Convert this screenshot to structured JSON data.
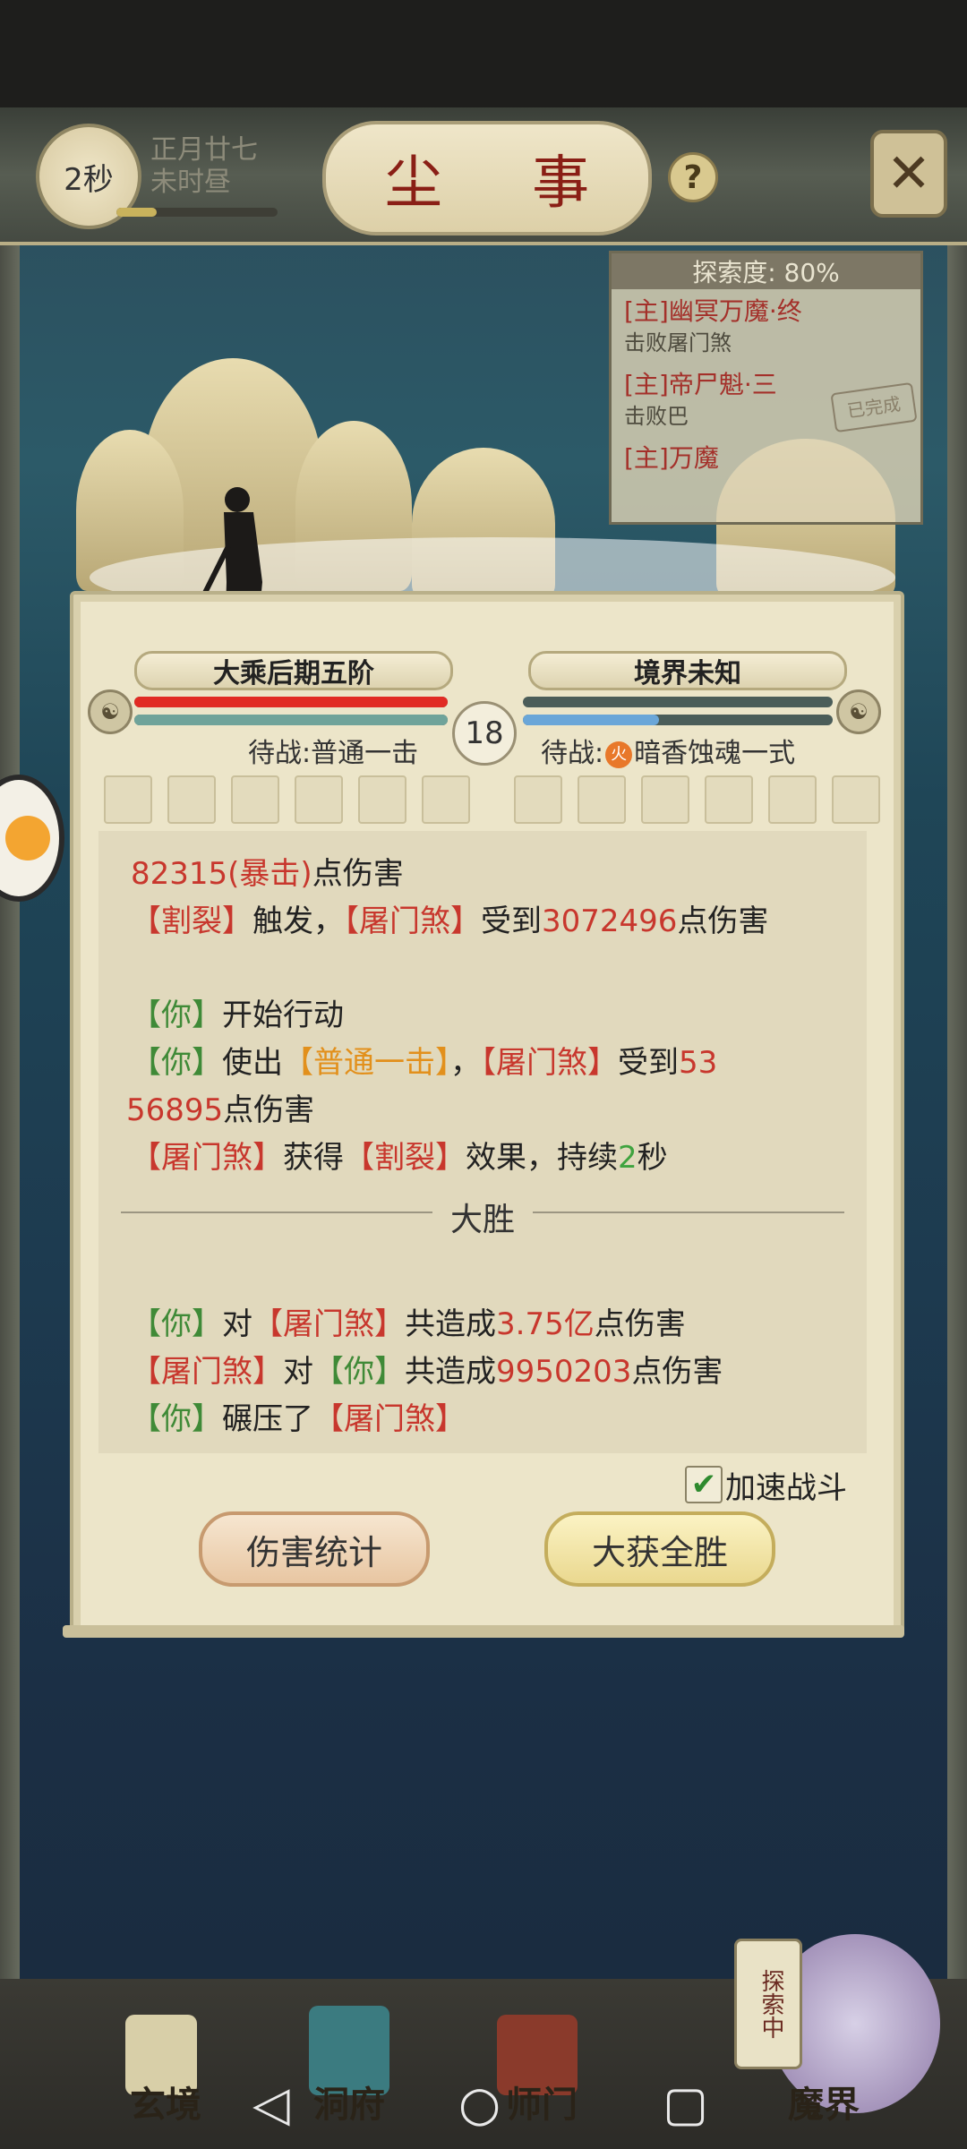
{
  "header": {
    "timer": "2秒",
    "date_line1": "正月廿七",
    "date_line2": "未时昼",
    "title": "尘 事",
    "help": "?"
  },
  "quest_panel": {
    "header": "探索度: 80%",
    "items": [
      {
        "title": "[主]幽冥万魔·终",
        "sub": "击败屠门煞"
      },
      {
        "title": "[主]帝尸魁·三",
        "sub": "击败巴"
      },
      {
        "title": "[主]万魔",
        "sub": ""
      }
    ],
    "stamp": "已完成"
  },
  "battle": {
    "player_realm": "大乘后期五阶",
    "enemy_realm": "境界未知",
    "round": "18",
    "player_status": "待战:普通一击",
    "enemy_status_prefix": "待战:",
    "enemy_element": "火",
    "enemy_status_skill": "暗香蚀魂一式",
    "player_hp": 1.0,
    "player_mp": 1.0,
    "enemy_hp": 0,
    "enemy_mp": 0.44
  },
  "log": {
    "l1_num": "82315",
    "l1_crit": "(暴击)",
    "l1_tail": "点伤害",
    "l2_a": "【割裂】",
    "l2_b": "触发，",
    "l2_c": "【屠门煞】",
    "l2_d": "受到",
    "l2_e": "3072496",
    "l2_f": "点伤害",
    "l3_a": "【你】",
    "l3_b": "开始行动",
    "l4_a": "【你】",
    "l4_b": "使出",
    "l4_c": "【普通一击】",
    "l4_d": "，",
    "l4_e": "【屠门煞】",
    "l4_f": "受到",
    "l4_g": "53",
    "l5_a": "56895",
    "l5_b": "点伤害",
    "l6_a": "【屠门煞】",
    "l6_b": "获得",
    "l6_c": "【割裂】",
    "l6_d": "效果，持续",
    "l6_e": "2",
    "l6_f": "秒",
    "result": "大胜",
    "s1_a": "【你】",
    "s1_b": "对",
    "s1_c": "【屠门煞】",
    "s1_d": "共造成",
    "s1_e": "3.75亿",
    "s1_f": "点伤害",
    "s2_a": "【屠门煞】",
    "s2_b": "对",
    "s2_c": "【你】",
    "s2_d": "共造成",
    "s2_e": "9950203",
    "s2_f": "点伤害",
    "s3_a": "【你】",
    "s3_b": "碾压了",
    "s3_c": "【屠门煞】"
  },
  "controls": {
    "speed_label": "加速战斗",
    "speed_checked": true,
    "damage_stats": "伤害统计",
    "victory": "大获全胜"
  },
  "bottom_nav": {
    "items": [
      "玄境",
      "洞府",
      "师门",
      "魔界"
    ],
    "explore_badge": "探索中"
  },
  "colors": {
    "enemy_red": "#c8372d",
    "you_green": "#3f8a37",
    "skill_orange": "#e2901c",
    "title_red": "#8a1f16"
  }
}
